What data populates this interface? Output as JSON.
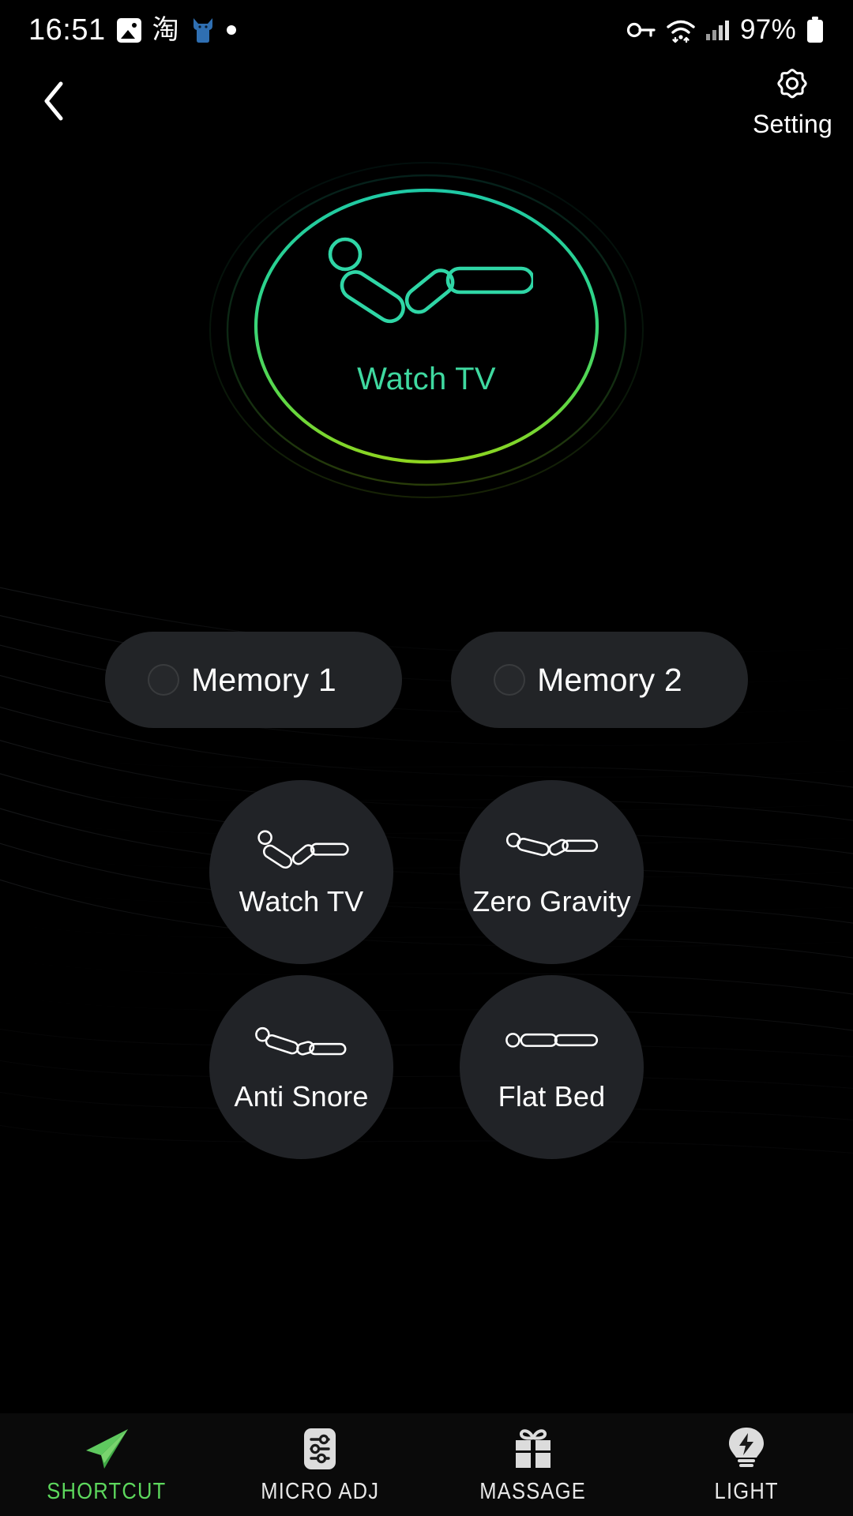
{
  "status_bar": {
    "time": "16:51",
    "left_icons": [
      "photo-icon",
      "taobao-icon",
      "cat-icon",
      "dot-icon"
    ],
    "right_icons": [
      "vpn-key-icon",
      "wifi-icon",
      "cellular-signal-icon"
    ],
    "battery_text": "97%",
    "battery_icon": "battery-full-icon"
  },
  "header": {
    "back_icon": "chevron-left-icon",
    "setting_icon": "gear-icon",
    "setting_label": "Setting"
  },
  "dial": {
    "icon": "bed-watch-tv-icon",
    "label": "Watch TV",
    "accent_top": "#2fd6a6",
    "accent_bottom": "#7ed321",
    "ring_gradient_start": "#28d39c",
    "ring_gradient_end": "#8cd627"
  },
  "memory_buttons": [
    {
      "label": "Memory 1",
      "knob_icon": "circle-knob-icon"
    },
    {
      "label": "Memory 2",
      "knob_icon": "circle-knob-icon"
    }
  ],
  "presets": [
    {
      "label": "Watch TV",
      "icon": "bed-watch-tv-icon"
    },
    {
      "label": "Zero Gravity",
      "icon": "bed-zero-gravity-icon"
    },
    {
      "label": "Anti Snore",
      "icon": "bed-anti-snore-icon"
    },
    {
      "label": "Flat Bed",
      "icon": "bed-flat-icon"
    }
  ],
  "bottom_nav": {
    "active_color": "#5dd85d",
    "items": [
      {
        "label": "SHORTCUT",
        "icon": "paper-plane-icon",
        "active": true
      },
      {
        "label": "MICRO ADJ",
        "icon": "sliders-icon",
        "active": false
      },
      {
        "label": "MASSAGE",
        "icon": "gift-icon",
        "active": false
      },
      {
        "label": "LIGHT",
        "icon": "bulb-icon",
        "active": false
      }
    ]
  }
}
